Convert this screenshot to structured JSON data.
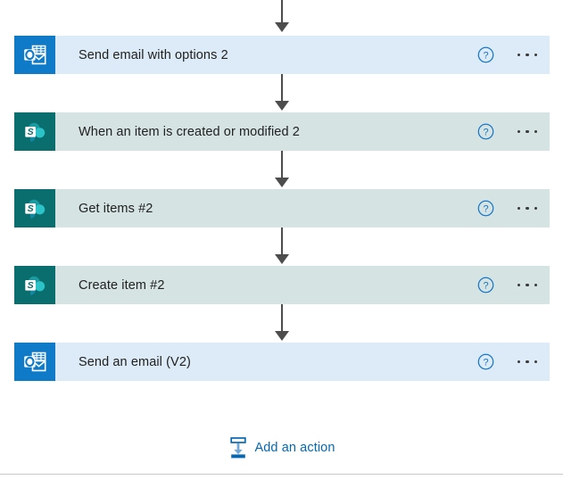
{
  "flow": {
    "steps": [
      {
        "label": "Send email with options 2",
        "connector": "SharePoint/Outlook",
        "icon": "outlook-icon",
        "theme": "outlook",
        "help_label": "?",
        "help_icon": "help-circle-icon",
        "menu_icon": "more-options-icon",
        "tile_color": "#0f7ac8",
        "body_color": "#dcebf7"
      },
      {
        "label": "When an item is created or modified 2",
        "connector": "SharePoint",
        "icon": "sharepoint-icon",
        "theme": "sharepoint",
        "help_label": "?",
        "help_icon": "help-circle-icon",
        "menu_icon": "more-options-icon",
        "tile_color": "#0a6e6e",
        "body_color": "#d5e3e2"
      },
      {
        "label": "Get items #2",
        "connector": "SharePoint",
        "icon": "sharepoint-icon",
        "theme": "sharepoint",
        "help_label": "?",
        "help_icon": "help-circle-icon",
        "menu_icon": "more-options-icon",
        "tile_color": "#0a6e6e",
        "body_color": "#d5e3e2"
      },
      {
        "label": "Create item #2",
        "connector": "SharePoint",
        "icon": "sharepoint-icon",
        "theme": "sharepoint",
        "help_label": "?",
        "help_icon": "help-circle-icon",
        "menu_icon": "more-options-icon",
        "tile_color": "#0a6e6e",
        "body_color": "#d5e3e2"
      },
      {
        "label": "Send an email (V2)",
        "connector": "Outlook",
        "icon": "outlook-icon",
        "theme": "outlook",
        "help_label": "?",
        "help_icon": "help-circle-icon",
        "menu_icon": "more-options-icon",
        "tile_color": "#0f7ac8",
        "body_color": "#dcebf7"
      }
    ],
    "add_action": {
      "label": "Add an action",
      "icon": "insert-below-icon",
      "color": "#0668b3"
    },
    "connector_color": "#4d4d4d",
    "accent_color": "#0f7ac8"
  }
}
